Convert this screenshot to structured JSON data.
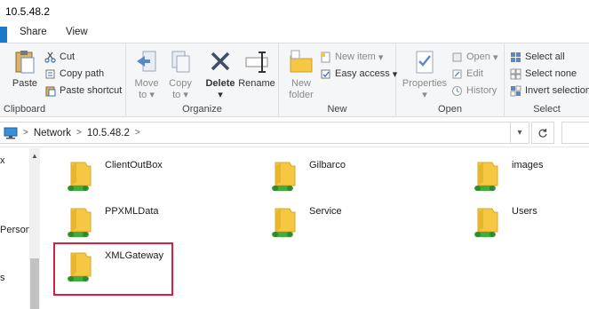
{
  "window": {
    "title": "10.5.48.2"
  },
  "tabs": [
    {
      "label": "Share"
    },
    {
      "label": "View"
    }
  ],
  "ribbon": {
    "clipboard": {
      "label": "Clipboard",
      "paste": "Paste",
      "cut": "Cut",
      "copy_path": "Copy path",
      "paste_shortcut": "Paste shortcut"
    },
    "organize": {
      "label": "Organize",
      "move_to_1": "Move",
      "move_to_2": "to",
      "copy_to_1": "Copy",
      "copy_to_2": "to",
      "delete": "Delete",
      "rename": "Rename"
    },
    "new": {
      "label": "New",
      "new_folder_1": "New",
      "new_folder_2": "folder",
      "new_item": "New item",
      "easy_access": "Easy access"
    },
    "open": {
      "label": "Open",
      "properties": "Properties",
      "open": "Open",
      "edit": "Edit",
      "history": "History"
    },
    "select": {
      "label": "Select",
      "select_all": "Select all",
      "select_none": "Select none",
      "invert_selection": "Invert selection"
    }
  },
  "address": {
    "items": [
      "Network",
      "10.5.48.2"
    ]
  },
  "navpane": {
    "items": [
      "x",
      "Person",
      "s"
    ]
  },
  "folders": [
    {
      "name": "ClientOutBox"
    },
    {
      "name": "Gilbarco"
    },
    {
      "name": "images"
    },
    {
      "name": "PPXMLData"
    },
    {
      "name": "Service"
    },
    {
      "name": "Users"
    },
    {
      "name": "XMLGateway"
    }
  ],
  "colors": {
    "accent": "#1979ca",
    "highlight": "#d4213d",
    "folder_yellow": "#f5c742",
    "network_green": "#3fae3f"
  }
}
